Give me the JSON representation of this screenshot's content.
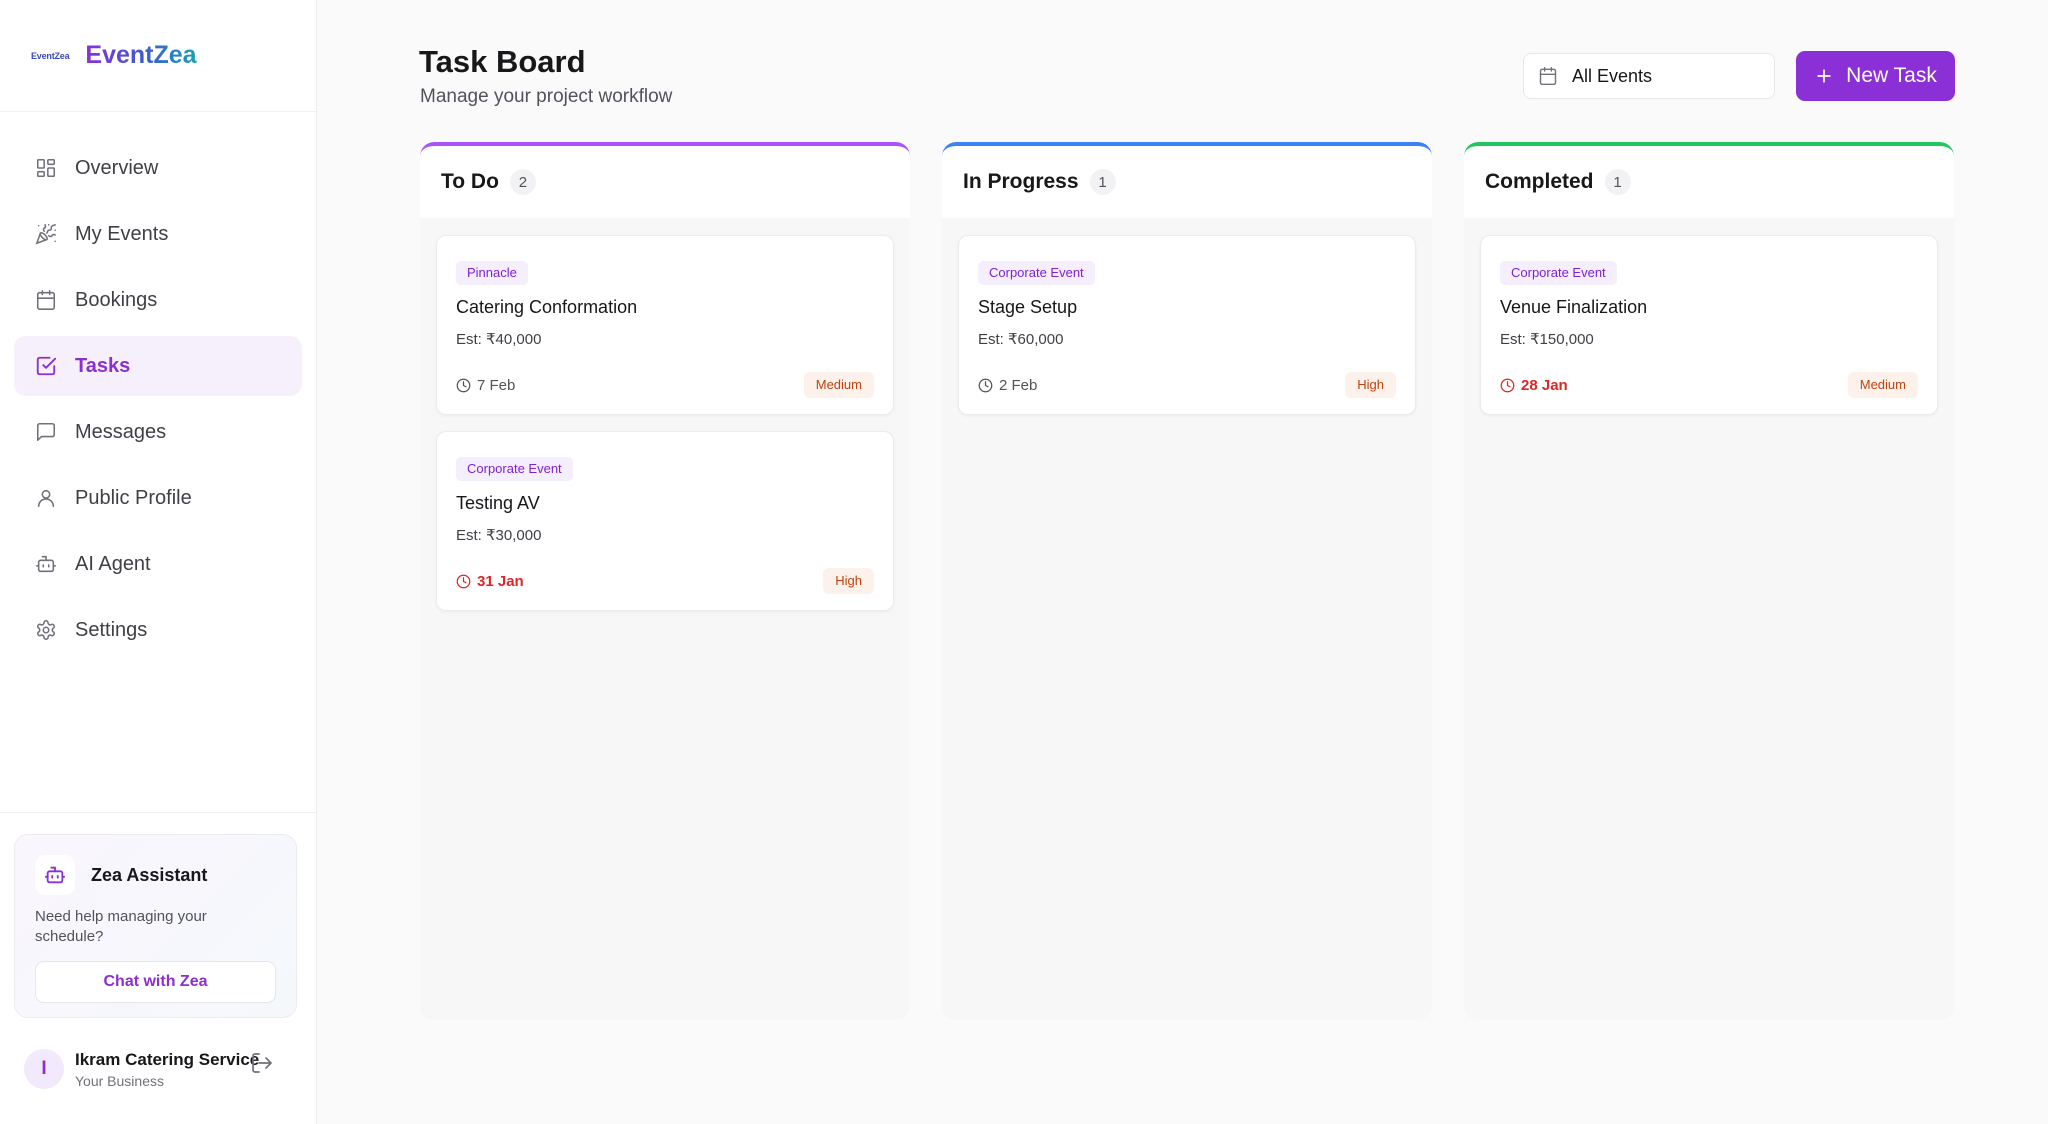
{
  "brand": {
    "logo_text": "EventZea",
    "name": "EventZea"
  },
  "sidebar": {
    "items": [
      {
        "label": "Overview",
        "icon": "grid-icon"
      },
      {
        "label": "My Events",
        "icon": "party-icon"
      },
      {
        "label": "Bookings",
        "icon": "calendar-icon"
      },
      {
        "label": "Tasks",
        "icon": "check-square-icon",
        "active": true
      },
      {
        "label": "Messages",
        "icon": "message-icon"
      },
      {
        "label": "Public Profile",
        "icon": "user-icon"
      },
      {
        "label": "AI Agent",
        "icon": "bot-icon"
      },
      {
        "label": "Settings",
        "icon": "gear-icon"
      }
    ]
  },
  "assistant": {
    "title": "Zea Assistant",
    "text": "Need help managing your schedule?",
    "button_label": "Chat with Zea"
  },
  "user": {
    "initial": "I",
    "name": "Ikram Catering Service",
    "role": "Your Business"
  },
  "header": {
    "title": "Task Board",
    "subtitle": "Manage your project workflow",
    "filter_label": "All Events",
    "new_task_label": "New Task"
  },
  "colors": {
    "accent": "#8b2fd6",
    "todo": "#a855f7",
    "in_progress": "#3b82f6",
    "completed": "#22c55e",
    "overdue": "#dc2626"
  },
  "columns": [
    {
      "title": "To Do",
      "count": "2",
      "cards": [
        {
          "tag": "Pinnacle",
          "title": "Catering Conformation",
          "estimate": "Est: ₹40,000",
          "date": "7 Feb",
          "overdue": false,
          "priority": "Medium"
        },
        {
          "tag": "Corporate Event",
          "title": "Testing AV",
          "estimate": "Est: ₹30,000",
          "date": "31 Jan",
          "overdue": true,
          "priority": "High"
        }
      ]
    },
    {
      "title": "In Progress",
      "count": "1",
      "cards": [
        {
          "tag": "Corporate Event",
          "title": "Stage Setup",
          "estimate": "Est: ₹60,000",
          "date": "2 Feb",
          "overdue": false,
          "priority": "High"
        }
      ]
    },
    {
      "title": "Completed",
      "count": "1",
      "cards": [
        {
          "tag": "Corporate Event",
          "title": "Venue Finalization",
          "estimate": "Est: ₹150,000",
          "date": "28 Jan",
          "overdue": true,
          "priority": "Medium"
        }
      ]
    }
  ]
}
